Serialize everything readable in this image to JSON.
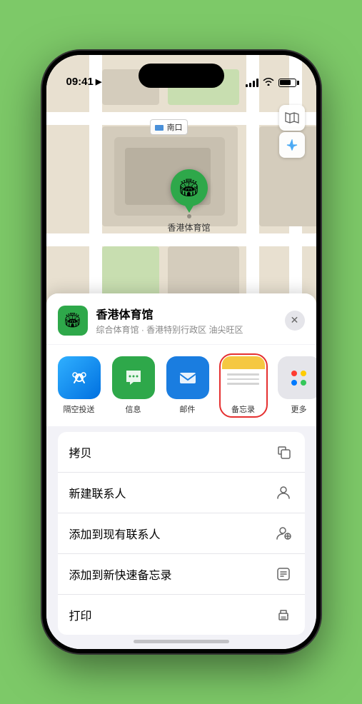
{
  "status_bar": {
    "time": "09:41",
    "location_icon": "▶"
  },
  "map": {
    "label": "南口",
    "label_prefix": "南口",
    "pin_label": "香港体育馆",
    "controls": {
      "map_icon": "🗺",
      "location_icon": "⬆"
    }
  },
  "sheet": {
    "venue_icon": "🏟",
    "venue_name": "香港体育馆",
    "venue_desc": "综合体育馆 · 香港特别行政区 油尖旺区",
    "close_label": "✕"
  },
  "share_items": [
    {
      "id": "airdrop",
      "label": "隔空投送",
      "icon": "📡",
      "type": "airdrop"
    },
    {
      "id": "messages",
      "label": "信息",
      "icon": "💬",
      "type": "messages"
    },
    {
      "id": "mail",
      "label": "邮件",
      "icon": "✉",
      "type": "mail"
    },
    {
      "id": "notes",
      "label": "备忘录",
      "icon": "📝",
      "type": "notes",
      "selected": true
    },
    {
      "id": "more",
      "label": "更多",
      "type": "more"
    }
  ],
  "actions": [
    {
      "id": "copy",
      "label": "拷贝",
      "icon": "copy"
    },
    {
      "id": "add-contact",
      "label": "新建联系人",
      "icon": "person"
    },
    {
      "id": "add-existing",
      "label": "添加到现有联系人",
      "icon": "person-add"
    },
    {
      "id": "add-note",
      "label": "添加到新快速备忘录",
      "icon": "note"
    },
    {
      "id": "print",
      "label": "打印",
      "icon": "print"
    }
  ]
}
